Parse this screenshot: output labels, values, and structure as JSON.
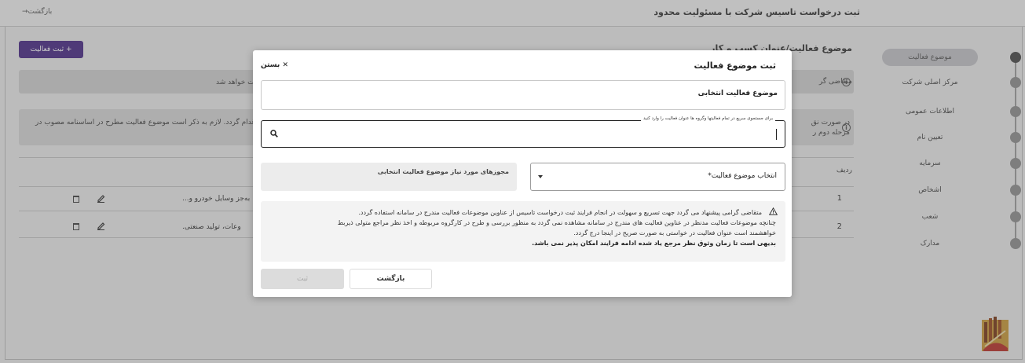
{
  "header": {
    "title": "ثبت درخواست تاسیس شرکت با مسئولیت محدود",
    "back_label": "بازگشت→"
  },
  "background": {
    "add_activity_label": "+ ثبت فعالیت",
    "heading_fragment": "موضوع فعالیت/عنوان کسب و کار",
    "info_fragment": "متقاضی گر",
    "info_text": "ست خواهد شد",
    "warn_fragment_1": "در صورت نق",
    "warn_fragment_2": "مرحله دوم ر",
    "warn_text": "قدام گردد. لازم به ذکر است موضوع فعالیت مطرح در اساسنامه مصوب در",
    "table_header_row": "ردیف",
    "rows": [
      {
        "num": "1",
        "text": "به‌جز وسایل خودرو و..."
      },
      {
        "num": "2",
        "text": "وعات، تولید صنعتی."
      }
    ]
  },
  "sidebar": {
    "steps": [
      {
        "label": "موضوع فعالیت"
      },
      {
        "label": "مرکز اصلی شرکت"
      },
      {
        "label": "اطلاعات عمومی"
      },
      {
        "label": "تعیین نام"
      },
      {
        "label": "سرمایه"
      },
      {
        "label": "اشخاص"
      },
      {
        "label": "شعب"
      },
      {
        "label": "مدارک"
      }
    ]
  },
  "modal": {
    "title": "ثبت موضوع فعالیت",
    "close_label": "✕ بستن",
    "selected_label": "موضوع فعالیت انتخابی",
    "search_legend": "برای جستجوی سریع در تمام فعالیتها وگروه ها عنوان فعالیت را وارد کنید",
    "search_value": "",
    "licenses_label": "مجوزهای مورد نیاز موضوع فعالیت انتخابی",
    "select_label": "انتخاب موضوع فعالیت*",
    "notice": {
      "line1": "متقاضی گرامی پیشنهاد می گردد جهت تسریع و سهولت در انجام فرایند ثبت درخواست تاسیس از عناوین موضوعات فعالیت مندرج در سامانه استفاده گردد.",
      "line2": "چنانچه موضوعات فعالیت مدنظر در عناوین فعالیت های مندرج در سامانه مشاهده نمی گردد به منظور بررسی و طرح در کارگروه مربوطه و اخذ نظر مراجع متولی ذیربط",
      "line3": "خواهشمند است عنوان فعالیت در خواستی به صورت صریح در اینجا درج گردد.",
      "line4": "بدیهی است تا زمان وثوق نظر مرجع یاد شده ادامه فرایند امکان پذیر نمی باشد."
    },
    "back_button": "بازگشت",
    "submit_button": "ثبت"
  },
  "colors": {
    "accent": "#4a2c86",
    "overlay": "#5a5a5a"
  }
}
